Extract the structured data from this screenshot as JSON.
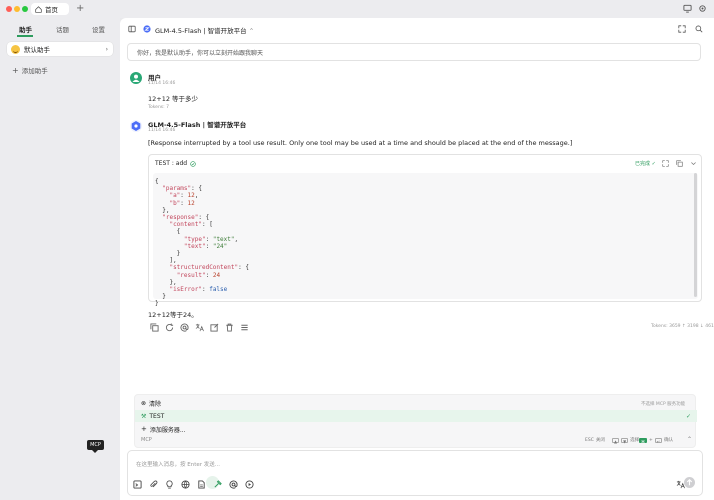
{
  "titlebar": {
    "tab_label": "首页",
    "new_tab": "+"
  },
  "colors": {
    "accent": "#2e9c5e",
    "sidebar_bg": "#ececef",
    "user_avatar": "#2aa876",
    "bot_avatar": "#4a6cf7"
  },
  "sidebar": {
    "tabs": [
      "助手",
      "话题",
      "设置"
    ],
    "assistant": "默认助手",
    "add_assistant": "添加助手"
  },
  "header": {
    "model": "GLM-4.5-Flash | 智谱开放平台"
  },
  "topic_placeholder": "你好，我是默认助手，你可以立刻开始跟我聊天",
  "user_msg": {
    "name": "用户",
    "time": "11/14 16:46",
    "text": "12+12 等于多少",
    "tokens": "Tokens: 7"
  },
  "bot_msg": {
    "name": "GLM-4.5-Flash | 智谱开放平台",
    "time": "11/14 16:46",
    "interrupt": "[Response interrupted by a tool use result. Only one tool may be used at a time and should be placed at the end of the message.]",
    "tool_title": "TEST : add",
    "tool_status": "已完成",
    "answer": "12+12等于24。",
    "tokens": "Tokens: 3659 ↑ 3198 ↓ 461"
  },
  "mcp": {
    "clear": "清除",
    "clear_hint": "不选择 MCP 服务功能",
    "server": "TEST",
    "add_server": "添加服务器...",
    "footer": "MCP",
    "esc": "ESC",
    "esc_label": "关闭",
    "select_label": "选择",
    "enter_key": "↵",
    "confirm_label": "确认"
  },
  "input": {
    "placeholder": "在这里输入消息，按 Enter 发送..."
  },
  "tooltip": "MCP"
}
